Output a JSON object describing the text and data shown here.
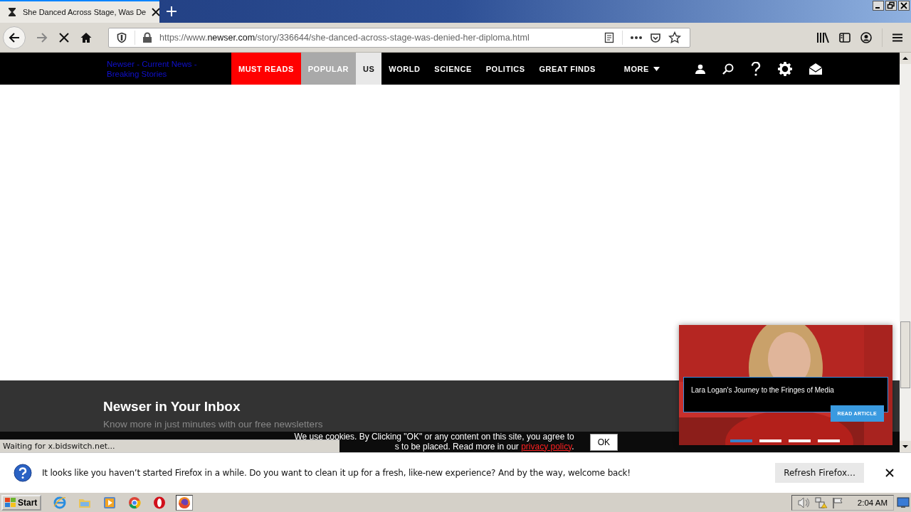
{
  "browser": {
    "tab": {
      "title": "She Danced Across Stage, Was De",
      "loading": true
    },
    "url": {
      "scheme": "https://www.",
      "host": "newser.com",
      "path": "/story/336644/she-danced-across-stage-was-denied-her-diploma.html"
    }
  },
  "site": {
    "logo_text": "Newser - Current News - Breaking Stories",
    "nav": [
      {
        "label": "MUST READS",
        "color": "#ff0000"
      },
      {
        "label": "POPULAR",
        "color": "#a9a9a9"
      },
      {
        "label": "US",
        "color": "#e8e8e8"
      },
      {
        "label": "WORLD",
        "color": "#000000"
      },
      {
        "label": "SCIENCE",
        "color": "#000000"
      },
      {
        "label": "POLITICS",
        "color": "#000000"
      },
      {
        "label": "GREAT FINDS",
        "color": "#000000"
      },
      {
        "label": "MORE",
        "color": "#000000"
      }
    ],
    "footer": {
      "heading": "Newser in Your Inbox",
      "subtitle": "Know more in just minutes with our free newsletters"
    }
  },
  "cookie": {
    "line1": "We use cookies. By Clicking \"OK\" or any content on this site, you agree to",
    "line2": "s to be placed. Read more in our",
    "link": "privacy policy",
    "end": ".",
    "button": "OK"
  },
  "status": "Waiting for x.bidswitch.net...",
  "popup": {
    "caption": "Lara Logan's Journey to the Fringes of Media",
    "button": "READ ARTICLE",
    "slides": [
      {
        "selected": true
      },
      {
        "selected": false
      },
      {
        "selected": false
      },
      {
        "selected": false
      }
    ]
  },
  "notification": {
    "message": "It looks like you haven’t started Firefox in a while. Do you want to clean it up for a fresh, like-new experience? And by the way, welcome back!",
    "button": "Refresh Firefox…"
  },
  "taskbar": {
    "start": "Start",
    "apps": [
      {
        "kind": "ie",
        "selected": false
      },
      {
        "kind": "folder",
        "selected": false
      },
      {
        "kind": "media",
        "selected": false
      },
      {
        "kind": "chrome",
        "selected": false
      },
      {
        "kind": "opera",
        "selected": false
      },
      {
        "kind": "firefox",
        "selected": true
      }
    ],
    "clock": "2:04 AM"
  }
}
